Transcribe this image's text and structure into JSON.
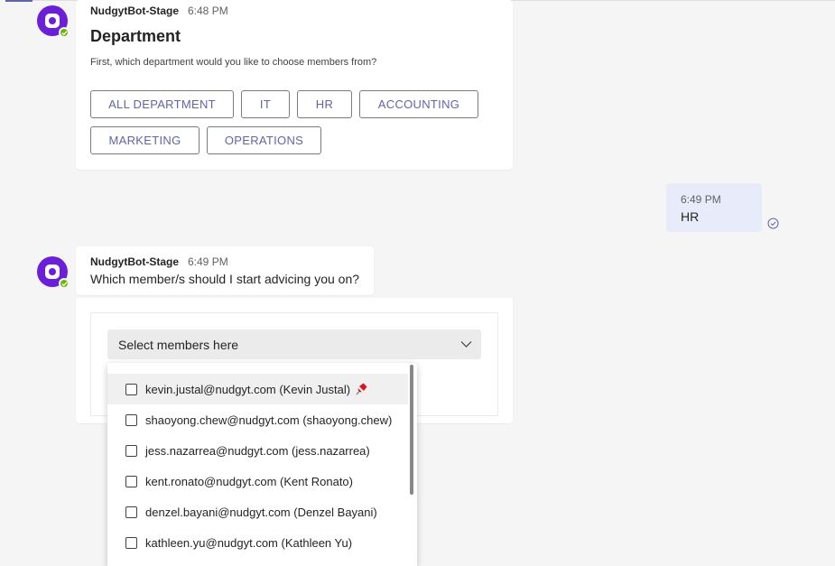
{
  "messages": [
    {
      "sender": "NudgytBot-Stage",
      "time": "6:48 PM",
      "title": "Department",
      "question": "First, which department would you like to choose members from?",
      "options": [
        "ALL DEPARTMENT",
        "IT",
        "HR",
        "ACCOUNTING",
        "MARKETING",
        "OPERATIONS"
      ]
    },
    {
      "time": "6:49 PM",
      "text": "HR"
    },
    {
      "sender": "NudgytBot-Stage",
      "time": "6:49 PM",
      "text": "Which member/s should I start advicing you on?"
    }
  ],
  "member_select": {
    "placeholder": "Select members here",
    "options": [
      "kevin.justal@nudgyt.com (Kevin Justal)",
      "shaoyong.chew@nudgyt.com (shaoyong.chew)",
      "jess.nazarrea@nudgyt.com (jess.nazarrea)",
      "kent.ronato@nudgyt.com (Kent Ronato)",
      "denzel.bayani@nudgyt.com (Denzel Bayani)",
      "kathleen.yu@nudgyt.com (Kathleen Yu)"
    ]
  },
  "colors": {
    "accent": "#6264a7",
    "bot_avatar": "#6b1fd6",
    "my_bubble": "#e8ebfa",
    "presence": "#6bb700"
  },
  "icons": [
    "bot-avatar-icon",
    "presence-available-icon",
    "seen-check-icon",
    "chevron-down-icon",
    "checkbox-icon",
    "pushpin-icon"
  ]
}
